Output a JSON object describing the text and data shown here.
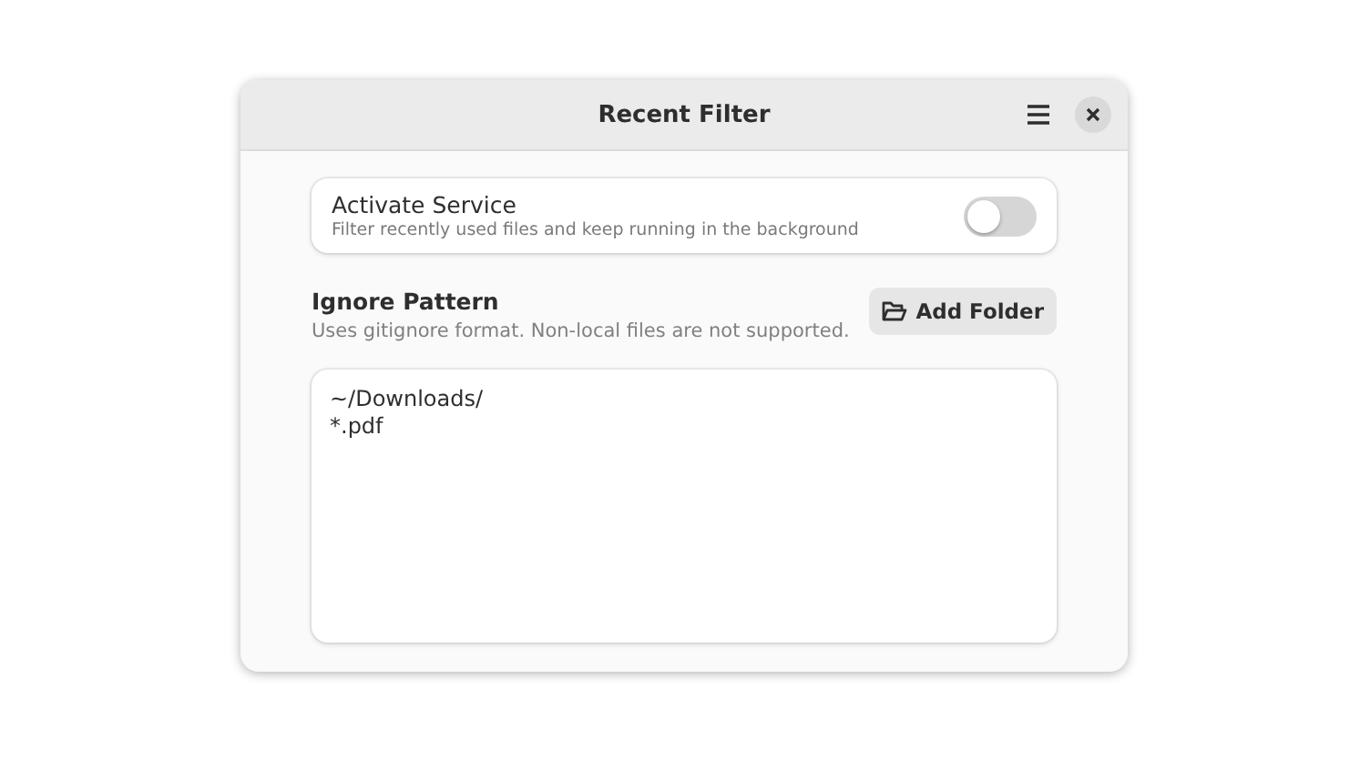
{
  "window": {
    "title": "Recent Filter"
  },
  "service": {
    "title": "Activate Service",
    "subtitle": "Filter recently used files and keep running in the background",
    "on": false
  },
  "ignore": {
    "title": "Ignore Pattern",
    "description": "Uses gitignore format. Non-local files are not supported.",
    "button": "Add Folder"
  },
  "patterns": [
    "~/Downloads/",
    "*.pdf"
  ]
}
